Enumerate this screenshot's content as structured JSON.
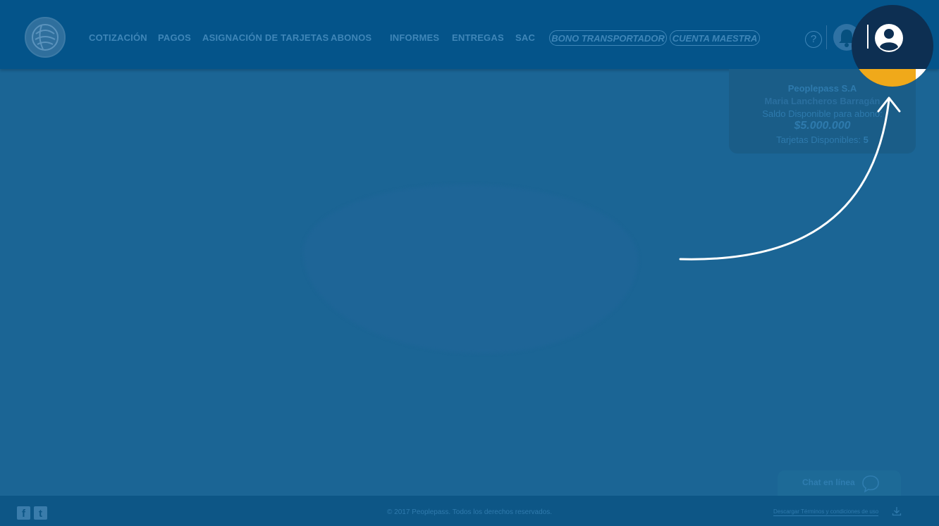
{
  "nav": {
    "items": [
      {
        "label": "COTIZACIÓN"
      },
      {
        "label": "PAGOS"
      },
      {
        "label": "ASIGNACIÓN DE TARJETAS"
      },
      {
        "label": "ABONOS"
      },
      {
        "label": "INFORMES"
      },
      {
        "label": "ENTREGAS"
      },
      {
        "label": "SAC"
      }
    ],
    "pills": [
      {
        "label": "BONO TRANSPORTADOR"
      },
      {
        "label": "CUENTA MAESTRA"
      }
    ],
    "help_label": "?"
  },
  "account": {
    "company": "Peoplepass S.A",
    "person": "Maria Lancheros Barragán",
    "saldo_label": "Saldo Disponible para abono:",
    "saldo_value": "$5.000.000",
    "cards_label": "Tarjetas Disponibles:",
    "cards_value": "5"
  },
  "chat": {
    "label": "Chat en línea"
  },
  "footer": {
    "copyright": "© 2017 Peoplepass. Todos los derechos reservados.",
    "terms": "Descargar Términos y condiciones de uso",
    "facebook_glyph": "f",
    "twitter_glyph": "t"
  },
  "colors": {
    "topbar": "#04548a",
    "overlay": "#1b6595",
    "accent_yellow": "#f0a91a",
    "spot_dark": "#0d2f52",
    "text_muted": "#3f86b8"
  }
}
